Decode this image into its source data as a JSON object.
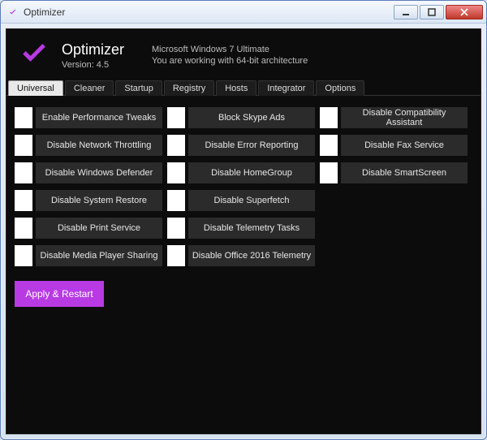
{
  "window": {
    "caption": "Optimizer"
  },
  "header": {
    "app_title": "Optimizer",
    "version_label": "Version: 4.5",
    "os_line1": "Microsoft Windows 7 Ultimate",
    "os_line2": "You are working with 64-bit architecture"
  },
  "tabs": [
    {
      "label": "Universal",
      "active": true
    },
    {
      "label": "Cleaner",
      "active": false
    },
    {
      "label": "Startup",
      "active": false
    },
    {
      "label": "Registry",
      "active": false
    },
    {
      "label": "Hosts",
      "active": false
    },
    {
      "label": "Integrator",
      "active": false
    },
    {
      "label": "Options",
      "active": false
    }
  ],
  "options": {
    "col1": [
      "Enable Performance Tweaks",
      "Disable Network Throttling",
      "Disable Windows Defender",
      "Disable System Restore",
      "Disable Print Service",
      "Disable Media Player Sharing"
    ],
    "col2": [
      "Block Skype Ads",
      "Disable Error Reporting",
      "Disable HomeGroup",
      "Disable Superfetch",
      "Disable Telemetry Tasks",
      "Disable Office 2016 Telemetry"
    ],
    "col3": [
      "Disable Compatibility Assistant",
      "Disable Fax Service",
      "Disable SmartScreen"
    ]
  },
  "apply_label": "Apply & Restart",
  "colors": {
    "accent": "#b73ae2",
    "bg_dark": "#0c0c0c",
    "option_bg": "#2b2b2b"
  }
}
